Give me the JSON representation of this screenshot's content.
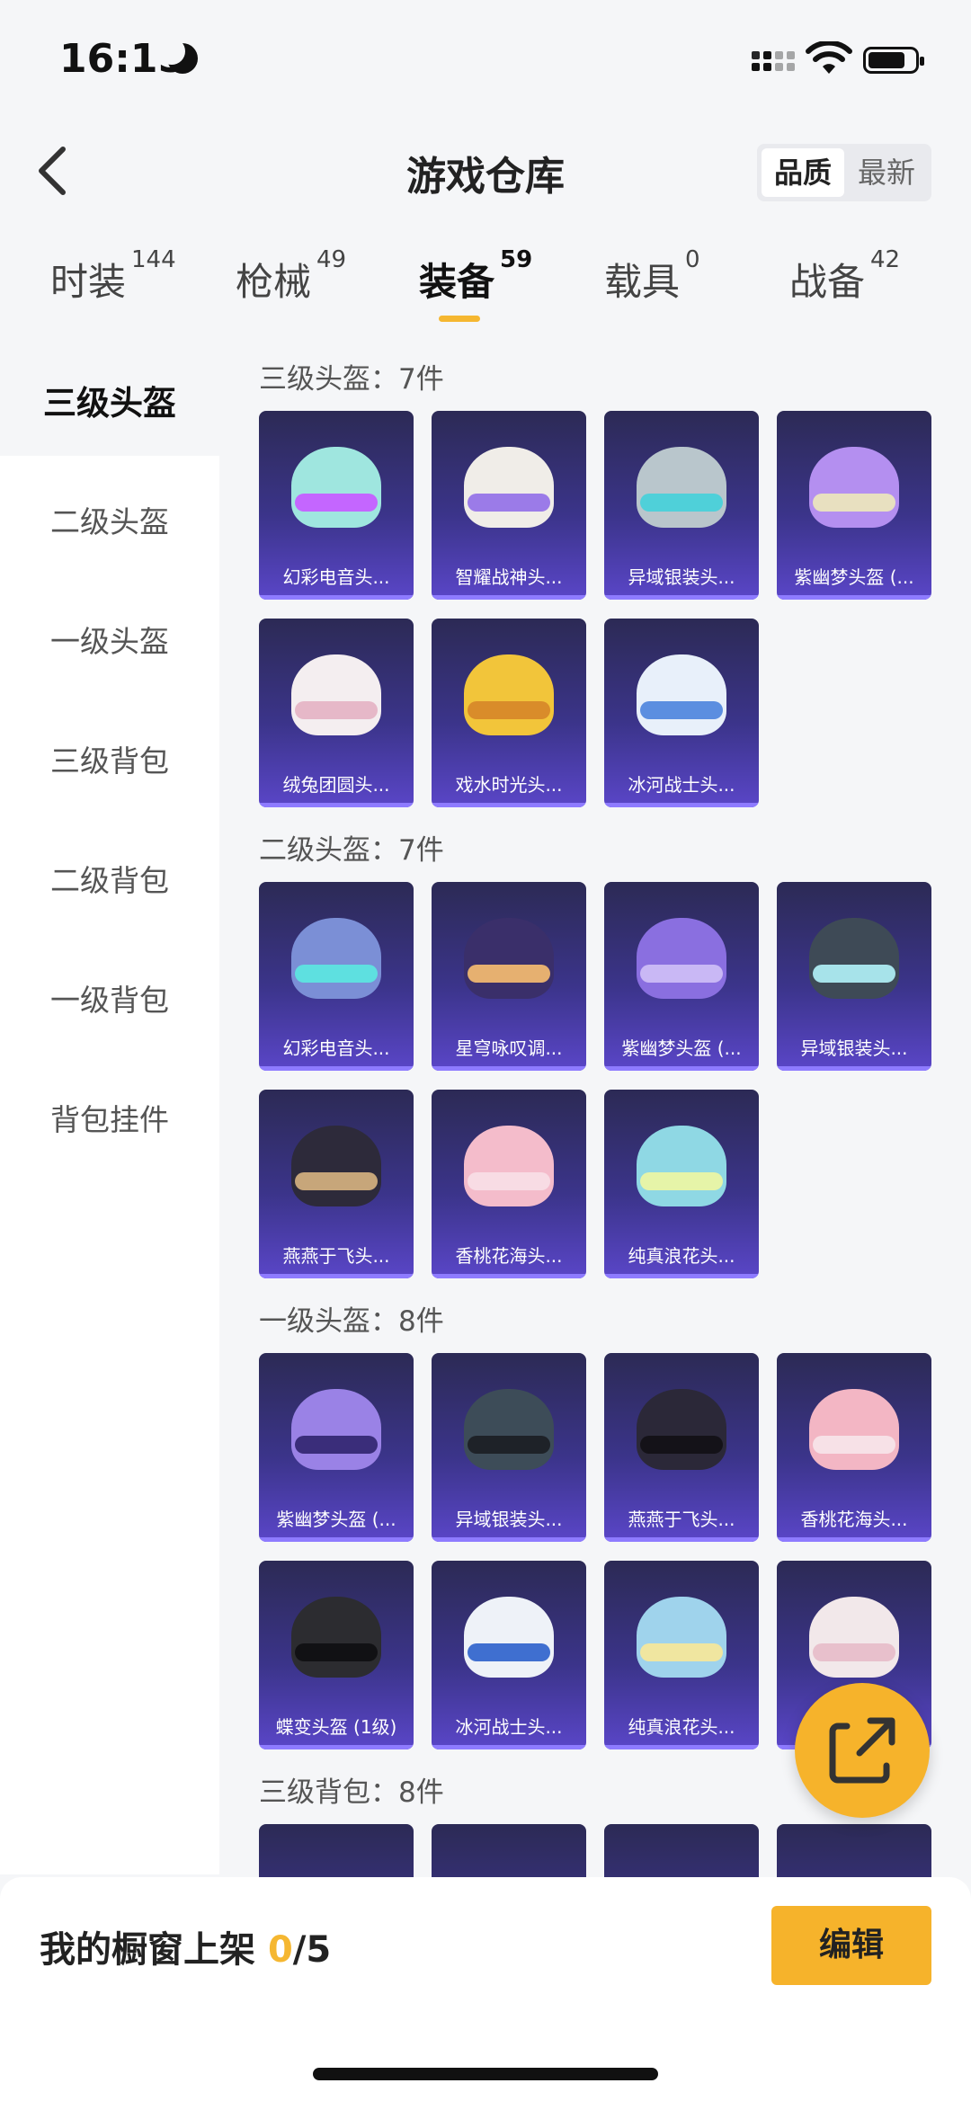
{
  "status": {
    "time": "16:15"
  },
  "header": {
    "title": "游戏仓库",
    "sort_quality": "品质",
    "sort_newest": "最新"
  },
  "tabs": [
    {
      "label": "时装",
      "count": "144"
    },
    {
      "label": "枪械",
      "count": "49"
    },
    {
      "label": "装备",
      "count": "59"
    },
    {
      "label": "载具",
      "count": "0"
    },
    {
      "label": "战备",
      "count": "42"
    }
  ],
  "sidebar": [
    "三级头盔",
    "二级头盔",
    "一级头盔",
    "三级背包",
    "二级背包",
    "一级背包",
    "背包挂件"
  ],
  "sections": [
    {
      "label": "三级头盔：7件",
      "items": [
        "幻彩电音头...",
        "智耀战神头...",
        "异域银装头...",
        "紫幽梦头盔 (...",
        "绒兔团圆头...",
        "戏水时光头...",
        "冰河战士头..."
      ]
    },
    {
      "label": "二级头盔：7件",
      "items": [
        "幻彩电音头...",
        "星穹咏叹调...",
        "紫幽梦头盔 (...",
        "异域银装头...",
        "燕燕于飞头...",
        "香桃花海头...",
        "纯真浪花头..."
      ]
    },
    {
      "label": "一级头盔：8件",
      "items": [
        "紫幽梦头盔 (...",
        "异域银装头...",
        "燕燕于飞头...",
        "香桃花海头...",
        "蝶变头盔 (1级)",
        "冰河战士头...",
        "纯真浪花头...",
        "桃..."
      ]
    },
    {
      "label": "三级背包：8件",
      "items": []
    }
  ],
  "bottom": {
    "shelf_label": "我的橱窗上架",
    "shelf_count": "0",
    "shelf_total": "/5",
    "edit_label": "编辑"
  }
}
